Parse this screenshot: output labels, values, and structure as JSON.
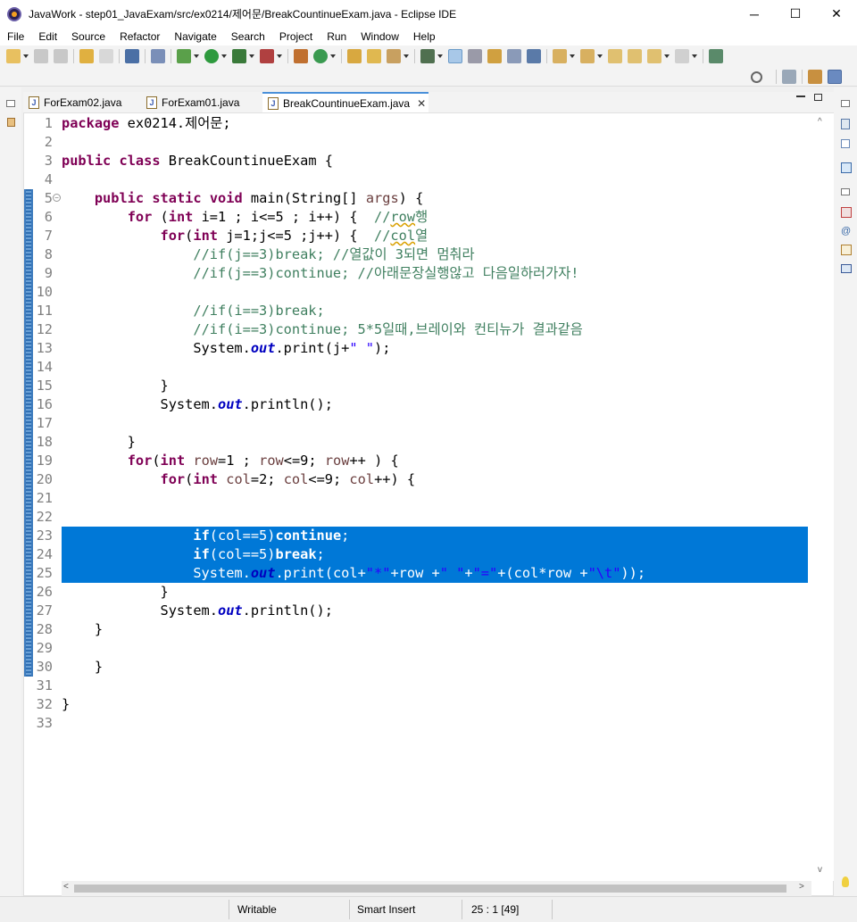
{
  "window": {
    "title": "JavaWork - step01_JavaExam/src/ex0214/제어문/BreakCountinueExam.java - Eclipse IDE",
    "minimize": "─",
    "maximize": "☐",
    "close": "✕"
  },
  "menu": [
    "File",
    "Edit",
    "Source",
    "Refactor",
    "Navigate",
    "Search",
    "Project",
    "Run",
    "Window",
    "Help"
  ],
  "tabs": [
    {
      "label": "ForExam02.java",
      "active": false
    },
    {
      "label": "ForExam01.java",
      "active": false
    },
    {
      "label": "BreakCountinueExam.java",
      "active": true
    }
  ],
  "editor": {
    "line_numbers": [
      "1",
      "2",
      "3",
      "4",
      "5",
      "6",
      "7",
      "8",
      "9",
      "10",
      "11",
      "12",
      "13",
      "14",
      "15",
      "16",
      "17",
      "18",
      "19",
      "20",
      "21",
      "22",
      "23",
      "24",
      "25",
      "26",
      "27",
      "28",
      "29",
      "30",
      "31",
      "32",
      "33"
    ],
    "selected_lines": [
      22,
      23,
      24
    ],
    "lines": [
      "package ex0214.제어문;",
      "",
      "public class BreakCountinueExam {",
      "",
      "    public static void main(String[] args) {",
      "        for (int i=1 ; i<=5 ; i++) {  //row행",
      "            for(int j=1;j<=5 ;j++) {  //col열",
      "                //if(j==3)break; //열값이 3되면 멈춰라",
      "                //if(j==3)continue; //아래문장실행않고 다음일하러가자!",
      "",
      "                //if(i==3)break;",
      "                //if(i==3)continue; 5*5일때,브레이와 컨티뉴가 결과같음",
      "                System.out.print(j+\" \");",
      "",
      "            }",
      "            System.out.println();",
      "",
      "        }",
      "        for(int row=1 ; row<=9; row++ ) {",
      "            for(int col=2; col<=9; col++) {",
      "",
      "",
      "                if(col==5)continue;",
      "                if(col==5)break;",
      "                System.out.print(col+\"*\"+row +\" \"+\"=\"+(col*row +\"\\t\"));",
      "            }",
      "            System.out.println();",
      "    }",
      "",
      "    }",
      "",
      "}",
      ""
    ]
  },
  "status": {
    "writable": "Writable",
    "insert_mode": "Smart Insert",
    "position": "25 : 1 [49]"
  }
}
